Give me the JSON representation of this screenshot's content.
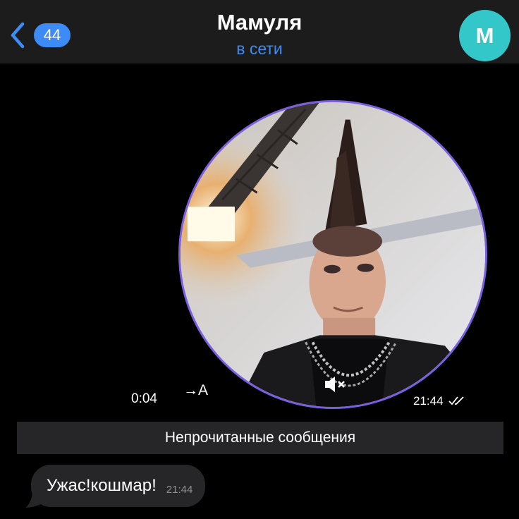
{
  "header": {
    "back_badge": "44",
    "title": "Мамуля",
    "status": "в сети",
    "avatar_letter": "M",
    "accent_color": "#3d8bf5",
    "avatar_color": "#34c7c9"
  },
  "video_message": {
    "duration": "0:04",
    "transcribe_label": "→A",
    "time": "21:44",
    "icons": [
      "muted-speaker-icon",
      "double-check-icon"
    ]
  },
  "unread_divider": "Непрочитанные сообщения",
  "messages": [
    {
      "text": "Ужас!кошмар!",
      "time": "21:44"
    }
  ]
}
